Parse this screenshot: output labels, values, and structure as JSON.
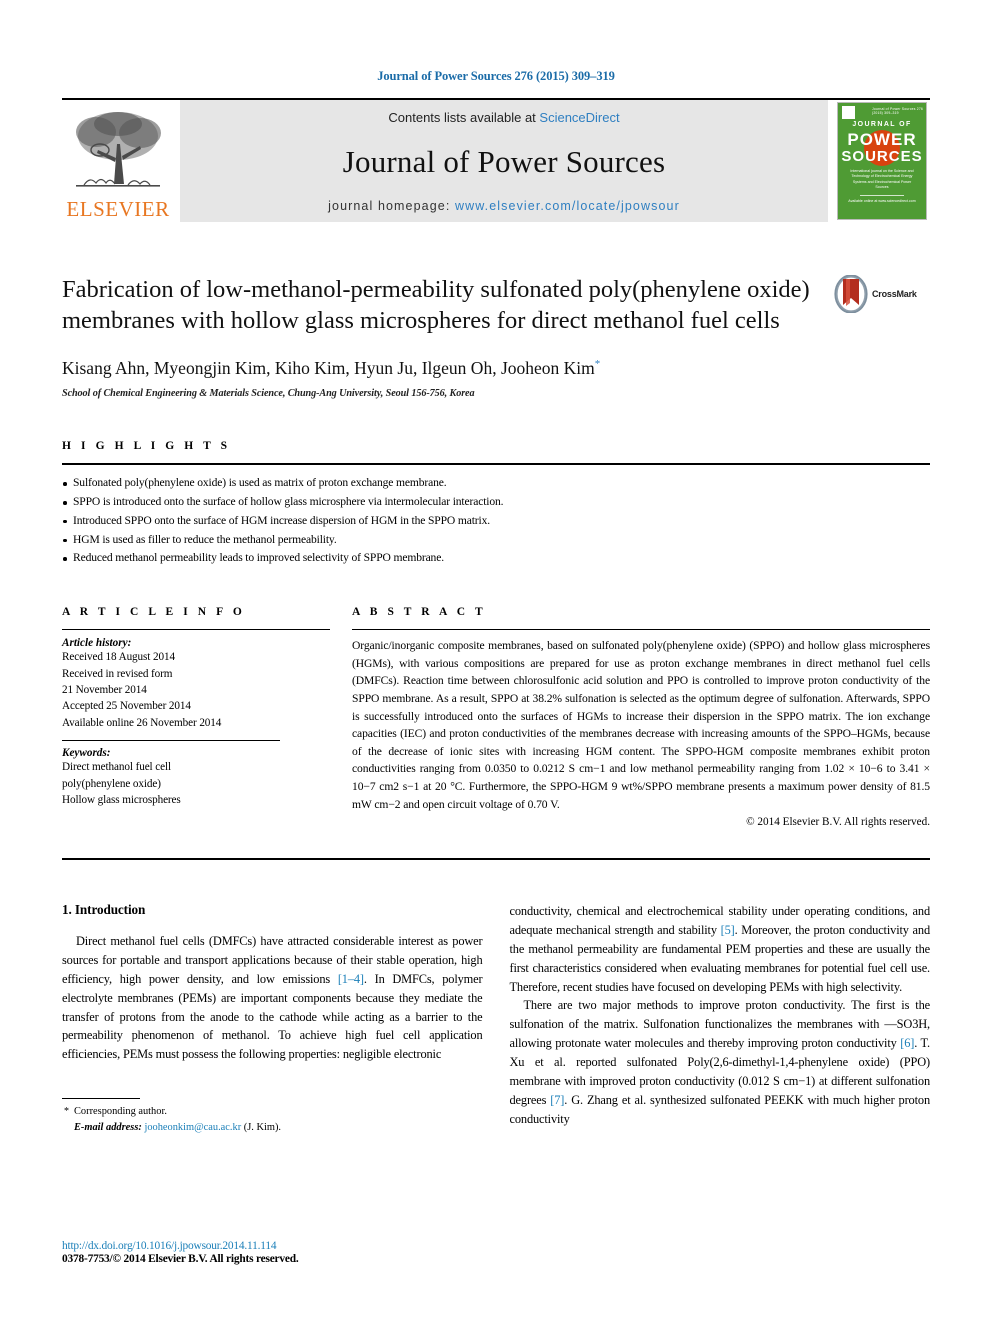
{
  "running_head": "Journal of Power Sources 276 (2015) 309–319",
  "header": {
    "publisher_name": "ELSEVIER",
    "contents_prefix": "Contents lists available at ",
    "contents_link": "ScienceDirect",
    "journal_title": "Journal of Power Sources",
    "homepage_prefix": "journal homepage: ",
    "homepage_url": "www.elsevier.com/locate/jpowsour",
    "cover": {
      "kicker": "JOURNAL OF",
      "word1": "POWER",
      "word2": "SOURCES",
      "tagline": "International journal on the Science and Technology of Electrochemical Energy Systems and Electrochemical Power Sources",
      "footer": "Available online at www.sciencedirect.com"
    }
  },
  "article": {
    "title": "Fabrication of low-methanol-permeability sulfonated poly(phenylene oxide) membranes with hollow glass microspheres for direct methanol fuel cells",
    "authors": "Kisang Ahn, Myeongjin Kim, Kiho Kim, Hyun Ju, Ilgeun Oh, Jooheon Kim",
    "corresponding_marker": "*",
    "affiliation": "School of Chemical Engineering & Materials Science, Chung-Ang University, Seoul 156-756, Korea",
    "crossmark_label": "CrossMark"
  },
  "highlights": {
    "heading": "H I G H L I G H T S",
    "items": [
      "Sulfonated poly(phenylene oxide) is used as matrix of proton exchange membrane.",
      "SPPO is introduced onto the surface of hollow glass microsphere via intermolecular interaction.",
      "Introduced SPPO onto the surface of HGM increase dispersion of HGM in the SPPO matrix.",
      "HGM is used as filler to reduce the methanol permeability.",
      "Reduced methanol permeability leads to improved selectivity of SPPO membrane."
    ]
  },
  "article_info": {
    "heading": "A R T I C L E   I N F O",
    "history_label": "Article history:",
    "history_lines": [
      "Received 18 August 2014",
      "Received in revised form",
      "21 November 2014",
      "Accepted 25 November 2014",
      "Available online 26 November 2014"
    ],
    "keywords_label": "Keywords:",
    "keywords": [
      "Direct methanol fuel cell",
      "poly(phenylene oxide)",
      "Hollow glass microspheres"
    ]
  },
  "abstract": {
    "heading": "A B S T R A C T",
    "text": "Organic/inorganic composite membranes, based on sulfonated poly(phenylene oxide) (SPPO) and hollow glass microspheres (HGMs), with various compositions are prepared for use as proton exchange membranes in direct methanol fuel cells (DMFCs). Reaction time between chlorosulfonic acid solution and PPO is controlled to improve proton conductivity of the SPPO membrane. As a result, SPPO at 38.2% sulfonation is selected as the optimum degree of sulfonation. Afterwards, SPPO is successfully introduced onto the surfaces of HGMs to increase their dispersion in the SPPO matrix. The ion exchange capacities (IEC) and proton conductivities of the membranes decrease with increasing amounts of the SPPO–HGMs, because of the decrease of ionic sites with increasing HGM content. The SPPO-HGM composite membranes exhibit proton conductivities ranging from 0.0350 to 0.0212 S cm−1 and low methanol permeability ranging from 1.02 × 10−6 to 3.41 × 10−7 cm2 s−1 at 20 °C. Furthermore, the SPPO-HGM 9 wt%/SPPO membrane presents a maximum power density of 81.5 mW cm−2 and open circuit voltage of 0.70 V.",
    "copyright": "© 2014 Elsevier B.V. All rights reserved."
  },
  "introduction": {
    "heading": "1.  Introduction",
    "left_para_1": "Direct methanol fuel cells (DMFCs) have attracted considerable interest as power sources for portable and transport applications because of their stable operation, high efficiency, high power density, and low emissions [1–4]. In DMFCs, polymer electrolyte membranes (PEMs) are important components because they mediate the transfer of protons from the anode to the cathode while acting as a barrier to the permeability phenomenon of methanol. To achieve high fuel cell application efficiencies, PEMs must possess the following properties: negligible electronic",
    "right_para_1": "conductivity, chemical and electrochemical stability under operating conditions, and adequate mechanical strength and stability [5]. Moreover, the proton conductivity and the methanol permeability are fundamental PEM properties and these are usually the first characteristics considered when evaluating membranes for potential fuel cell use. Therefore, recent studies have focused on developing PEMs with high selectivity.",
    "right_para_2": "There are two major methods to improve proton conductivity. The first is the sulfonation of the matrix. Sulfonation functionalizes the membranes with —SO3H, allowing protonate water molecules and thereby improving proton conductivity [6]. T. Xu et al. reported sulfonated Poly(2,6-dimethyl-1,4-phenylene oxide) (PPO) membrane with improved proton conductivity (0.012 S cm−1) at different sulfonation degrees [7]. G. Zhang et al. synthesized sulfonated PEEKK with much higher proton conductivity"
  },
  "footnote": {
    "star": "*",
    "corresponding": "Corresponding author.",
    "email_label": "E-mail address:",
    "email": "jooheonkim@cau.ac.kr",
    "email_suffix": "(J. Kim)."
  },
  "footer": {
    "doi": "http://dx.doi.org/10.1016/j.jpowsour.2014.11.114",
    "issn": "0378-7753/© 2014 Elsevier B.V. All rights reserved."
  },
  "colors": {
    "link_blue": "#1b7fb8",
    "banner_gray": "#e6e6e6",
    "elsevier_orange": "#E87722",
    "cover_green": "#4f9b34",
    "cover_orange": "#d8430f"
  }
}
